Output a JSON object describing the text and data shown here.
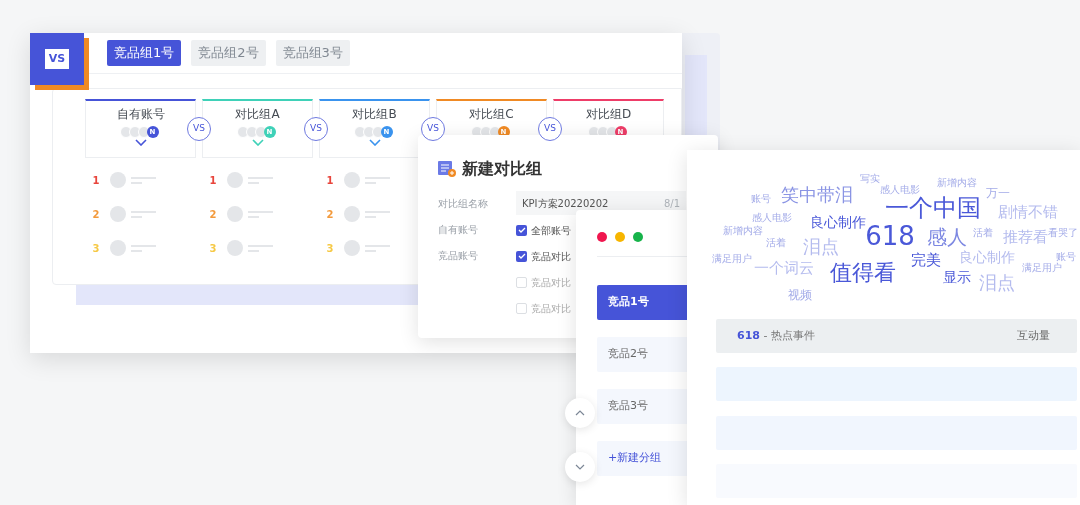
{
  "logo": {
    "text": "VS"
  },
  "group_tabs": [
    {
      "label": "竞品组1号",
      "selected": true
    },
    {
      "label": "竞品组2号",
      "selected": false
    },
    {
      "label": "竞品组3号",
      "selected": false
    }
  ],
  "compare_columns": [
    {
      "title": "自有账号",
      "badge": "N",
      "color": "#4654d8",
      "expanded": true
    },
    {
      "title": "对比组A",
      "badge": "N",
      "color": "#3fd1b8",
      "expanded": true
    },
    {
      "title": "对比组B",
      "badge": "N",
      "color": "#3a93ee",
      "expanded": true
    },
    {
      "title": "对比组C",
      "badge": "N",
      "color": "#f08a24"
    },
    {
      "title": "对比组D",
      "badge": "N",
      "color": "#ee3d68"
    }
  ],
  "vs_badges": [
    "VS",
    "VS",
    "VS",
    "VS"
  ],
  "ranking_columns": [
    {
      "ranks": [
        {
          "rank": "1",
          "color": "#e8453c"
        },
        {
          "rank": "2",
          "color": "#f39a3c"
        },
        {
          "rank": "3",
          "color": "#f6c945"
        }
      ]
    },
    {
      "ranks": [
        {
          "rank": "1",
          "color": "#e8453c"
        },
        {
          "rank": "2",
          "color": "#f39a3c"
        },
        {
          "rank": "3",
          "color": "#f6c945"
        }
      ]
    },
    {
      "ranks": [
        {
          "rank": "1",
          "color": "#e8453c"
        },
        {
          "rank": "2",
          "color": "#f39a3c"
        },
        {
          "rank": "3",
          "color": "#f6c945"
        }
      ]
    }
  ],
  "dialog": {
    "title": "新建对比组",
    "fields": [
      {
        "label": "对比组名称",
        "kind": "input",
        "value": "KPI方案20220202",
        "counter": "8/1"
      },
      {
        "label": "自有账号",
        "kind": "checks",
        "options": [
          {
            "label": "全部账号",
            "checked": true
          }
        ]
      },
      {
        "label": "竞品账号",
        "kind": "checks",
        "options": [
          {
            "label": "竞品对比",
            "checked": true
          },
          {
            "label": "竞品对比",
            "checked": false
          },
          {
            "label": "竞品对比",
            "checked": false
          }
        ]
      }
    ]
  },
  "group_list": {
    "items": [
      {
        "label": "竞品1号",
        "kind": "group",
        "selected": true
      },
      {
        "label": "竞品2号",
        "kind": "group",
        "selected": false
      },
      {
        "label": "竞品3号",
        "kind": "group",
        "selected": false
      },
      {
        "label": "+新建分组",
        "kind": "add",
        "selected": false
      }
    ]
  },
  "word_cloud": {
    "words": [
      {
        "text": "账号",
        "color": "#a3abe8"
      },
      {
        "text": "笑中带泪",
        "color": "#8a94e4"
      },
      {
        "text": "写实",
        "color": "#a3abe8"
      },
      {
        "text": "感人电影",
        "color": "#a3abe8"
      },
      {
        "text": "新增内容",
        "color": "#a3abe8"
      },
      {
        "text": "万一",
        "color": "#a3abe8"
      },
      {
        "text": "感人电影",
        "color": "#a3abe8"
      },
      {
        "text": "良心制作",
        "color": "#4a58d8"
      },
      {
        "text": "一个中国",
        "color": "#4a58d8"
      },
      {
        "text": "剧情不错",
        "color": "#b4bbee"
      },
      {
        "text": "新增内容",
        "color": "#a3abe8"
      },
      {
        "text": "活着",
        "color": "#a3abe8"
      },
      {
        "text": "泪点",
        "color": "#b4bbee"
      },
      {
        "text": "618",
        "color": "#4a58d8"
      },
      {
        "text": "感人",
        "color": "#7d88e2"
      },
      {
        "text": "活着",
        "color": "#a3abe8"
      },
      {
        "text": "推荐看",
        "color": "#b4bbee"
      },
      {
        "text": "看哭了",
        "color": "#a3abe8"
      },
      {
        "text": "满足用户",
        "color": "#a3abe8"
      },
      {
        "text": "一个词云",
        "color": "#b4bbee"
      },
      {
        "text": "值得看",
        "color": "#4a58d8"
      },
      {
        "text": "完美",
        "color": "#4a58d8"
      },
      {
        "text": "显示",
        "color": "#4a58d8"
      },
      {
        "text": "良心制作",
        "color": "#b4bbee"
      },
      {
        "text": "泪点",
        "color": "#b4bbee"
      },
      {
        "text": "满足用户",
        "color": "#a3abe8"
      },
      {
        "text": "账号",
        "color": "#a3abe8"
      },
      {
        "text": "视频",
        "color": "#a3abe8"
      }
    ]
  },
  "hot_table": {
    "highlight": "618",
    "topic": "- 热点事件",
    "metric": "互动量"
  }
}
